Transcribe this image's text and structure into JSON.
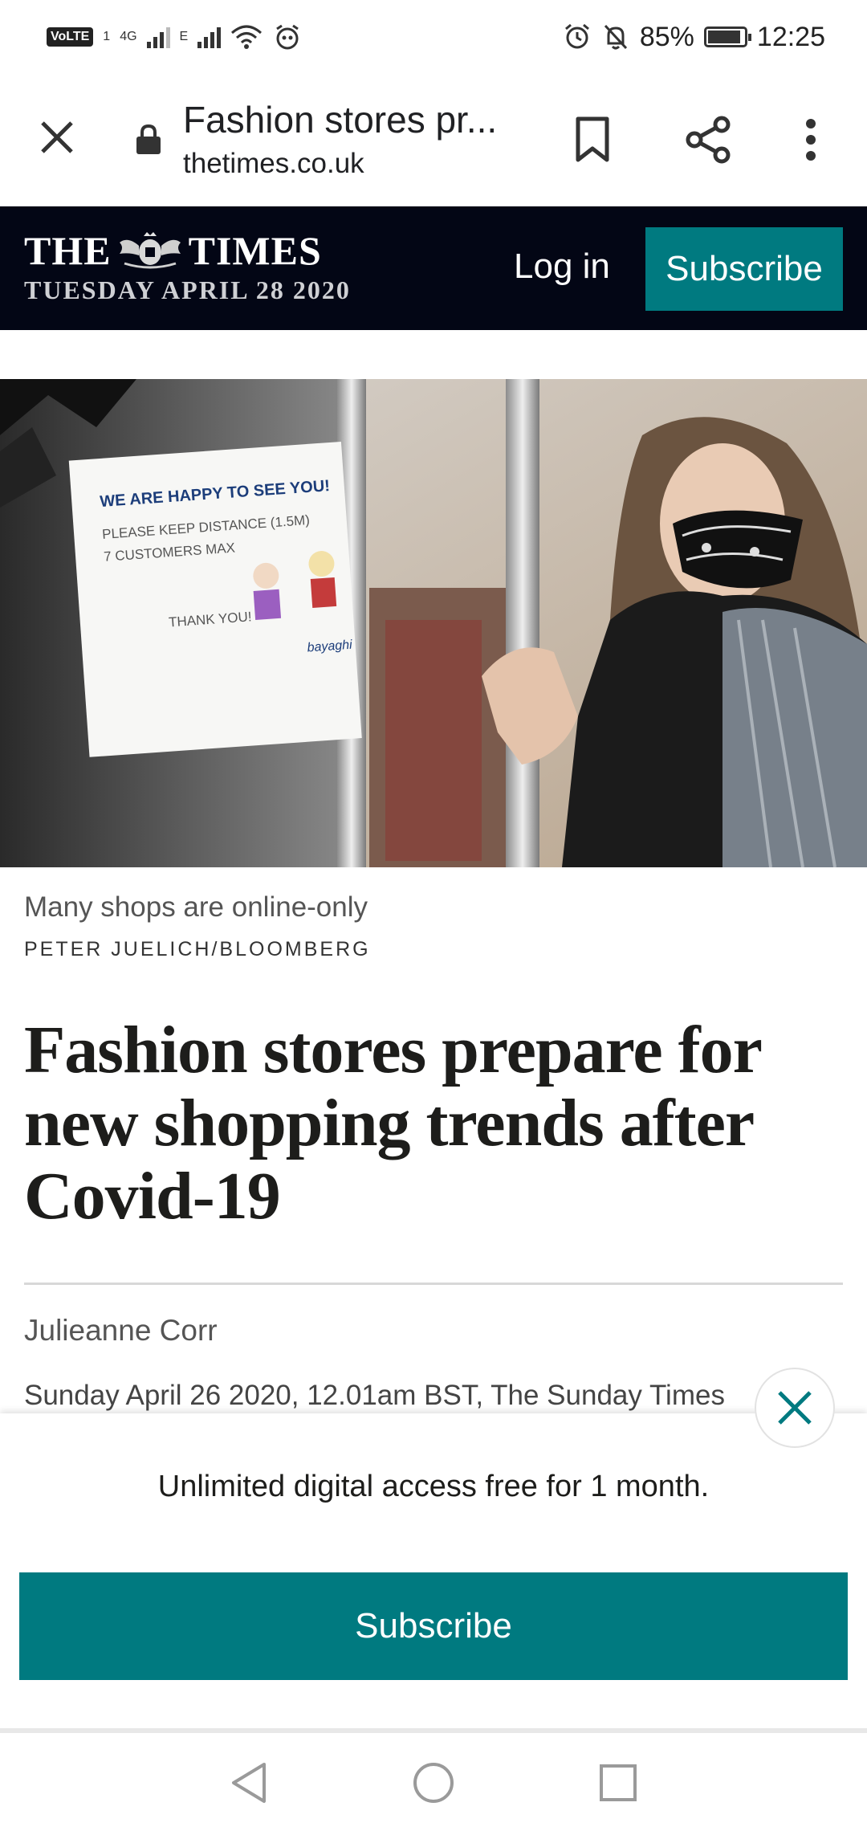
{
  "status_bar": {
    "volte": "VoLTE",
    "sim": "1",
    "network_4g": "4G",
    "network_e": "E",
    "battery": "85%",
    "time": "12:25",
    "battery_level": 0.85
  },
  "browser": {
    "page_title": "Fashion stores pr...",
    "url": "thetimes.co.uk",
    "icons": [
      "close-icon",
      "lock-icon",
      "bookmark-icon",
      "share-icon",
      "more-vert-icon"
    ]
  },
  "header": {
    "masthead_left": "THE",
    "masthead_right": "TIMES",
    "date": "TUESDAY APRIL 28 2020",
    "login_label": "Log in",
    "subscribe_label": "Subscribe",
    "background": "#030615",
    "accent": "#007a80"
  },
  "hero": {
    "sign_line1": "WE ARE HAPPY TO SEE YOU!",
    "sign_line2": "PLEASE KEEP DISTANCE (1.5M)",
    "sign_line3": "7 CUSTOMERS MAX",
    "sign_line4": "THANK YOU!",
    "sign_signature": "bayaghi"
  },
  "article": {
    "caption": "Many shops are online-only",
    "credit": "PETER JUELICH/BLOOMBERG",
    "headline": "Fashion stores prepare for new shopping trends after Covid-19",
    "author": "Julieanne Corr",
    "published": "Sunday April 26 2020, 12.01am BST, The Sunday Times"
  },
  "overlay": {
    "offer_text": "Unlimited digital access free for 1 month.",
    "subscribe_label": "Subscribe",
    "close_icon": "close-icon"
  },
  "nav": {
    "icons": [
      "back-icon",
      "home-icon",
      "recents-icon"
    ]
  }
}
